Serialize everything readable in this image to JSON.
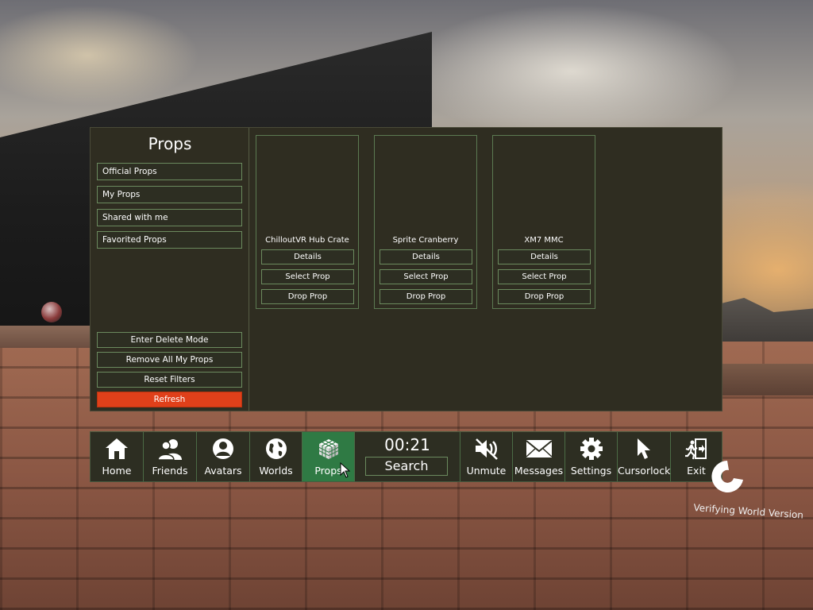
{
  "panel": {
    "title": "Props",
    "filters": [
      "Official Props",
      "My Props",
      "Shared with me",
      "Favorited Props"
    ],
    "actions": {
      "enter_delete": "Enter Delete Mode",
      "remove_all": "Remove All My Props",
      "reset_filters": "Reset Filters",
      "refresh": "Refresh"
    },
    "props": [
      {
        "name": "ChilloutVR Hub Crate",
        "details": "Details",
        "select": "Select Prop",
        "drop": "Drop Prop"
      },
      {
        "name": "Sprite Cranberry",
        "details": "Details",
        "select": "Select Prop",
        "drop": "Drop Prop"
      },
      {
        "name": "XM7 MMC",
        "details": "Details",
        "select": "Select Prop",
        "drop": "Drop Prop"
      }
    ]
  },
  "menu": {
    "clock": "00:21",
    "search": "Search",
    "items": [
      {
        "label": "Home",
        "icon": "home-icon"
      },
      {
        "label": "Friends",
        "icon": "friends-icon"
      },
      {
        "label": "Avatars",
        "icon": "avatar-icon"
      },
      {
        "label": "Worlds",
        "icon": "globe-icon"
      },
      {
        "label": "Props",
        "icon": "cube-icon"
      },
      {
        "label": "Unmute",
        "icon": "speaker-muted-icon"
      },
      {
        "label": "Messages",
        "icon": "envelope-icon"
      },
      {
        "label": "Settings",
        "icon": "gear-icon"
      },
      {
        "label": "Cursorlock",
        "icon": "cursor-icon"
      },
      {
        "label": "Exit",
        "icon": "exit-icon"
      }
    ]
  },
  "status": {
    "text": "Verifying World Version"
  },
  "colors": {
    "accent_refresh": "#e0401a",
    "active_tab": "#2f7a44",
    "panel_bg": "#2f2d21"
  }
}
